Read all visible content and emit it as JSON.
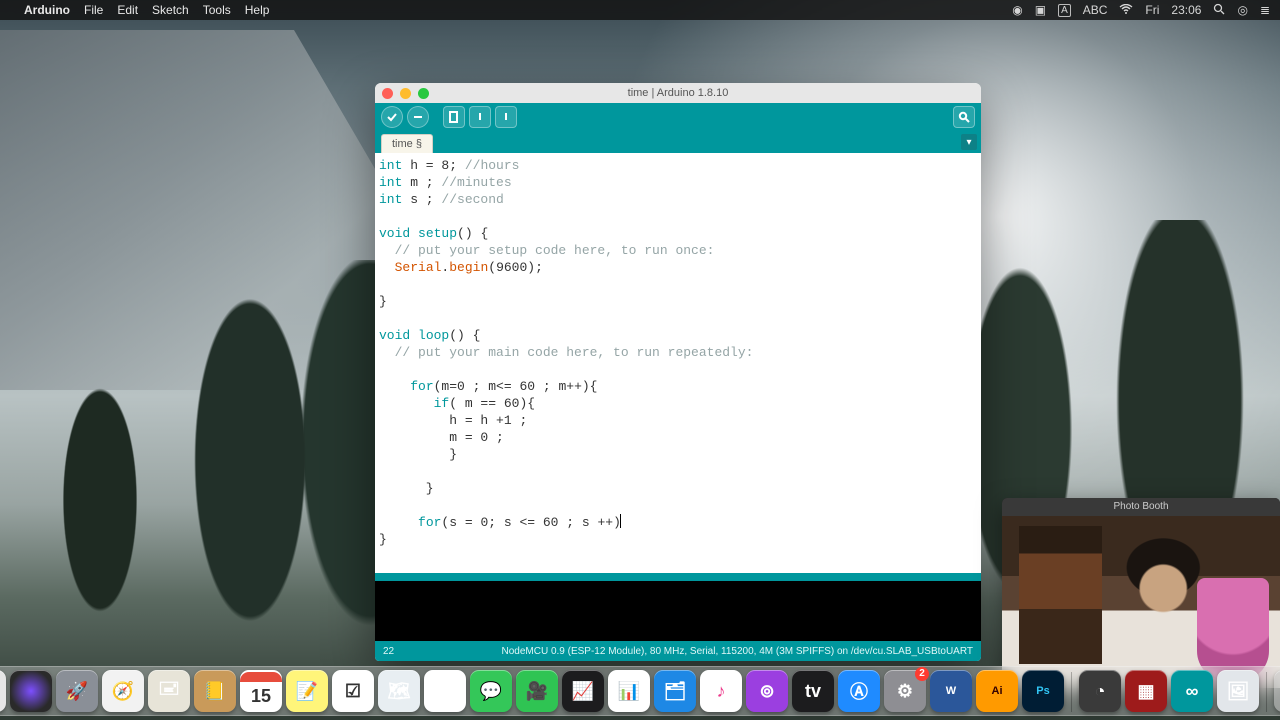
{
  "menubar": {
    "app": "Arduino",
    "items": [
      "File",
      "Edit",
      "Sketch",
      "Tools",
      "Help"
    ],
    "right": {
      "input": "A",
      "lang": "ABC",
      "day": "Fri",
      "time": "23:06"
    }
  },
  "arduino": {
    "title": "time | Arduino 1.8.10",
    "tab": "time §",
    "status_line": "22",
    "status_board": "NodeMCU 0.9 (ESP-12 Module), 80 MHz, Serial, 115200, 4M (3M SPIFFS) on /dev/cu.SLAB_USBtoUART",
    "code": {
      "l1a": "int",
      "l1b": " h = ",
      "l1c": "8",
      "l1d": "; ",
      "l1e": "//hours",
      "l2a": "int",
      "l2b": " m ; ",
      "l2c": "//minutes",
      "l3a": "int",
      "l3b": " s ; ",
      "l3c": "//second",
      "l5a": "void",
      "l5b": " ",
      "l5c": "setup",
      "l5d": "() {",
      "l6": "  // put your setup code here, to run once:",
      "l7a": "  ",
      "l7b": "Serial",
      "l7c": ".",
      "l7d": "begin",
      "l7e": "(",
      "l7f": "9600",
      "l7g": ");",
      "l9": "}",
      "l11a": "void",
      "l11b": " ",
      "l11c": "loop",
      "l11d": "() {",
      "l12": "  // put your main code here, to run repeatedly:",
      "l14a": "    ",
      "l14b": "for",
      "l14c": "(m=",
      "l14d": "0",
      "l14e": " ; m<= ",
      "l14f": "60",
      "l14g": " ; m++){",
      "l15a": "       ",
      "l15b": "if",
      "l15c": "( m == ",
      "l15d": "60",
      "l15e": "){",
      "l16a": "         h = h +",
      "l16b": "1",
      "l16c": " ;",
      "l17a": "         m = ",
      "l17b": "0",
      "l17c": " ;",
      "l18": "         }",
      "l20": "      }",
      "l22a": "     ",
      "l22b": "for",
      "l22c": "(s = ",
      "l22d": "0",
      "l22e": "; s <= ",
      "l22f": "60",
      "l22g": " ; s ++)",
      "l23": "}"
    }
  },
  "photobooth": {
    "title": "Photo Booth"
  },
  "dock": {
    "calendar_month": "MAY",
    "calendar_day": "15",
    "prefs_badge": "2",
    "ai": "Ai",
    "ps": "Ps",
    "word": "W",
    "obs": "◔",
    "arduino": "∞"
  }
}
